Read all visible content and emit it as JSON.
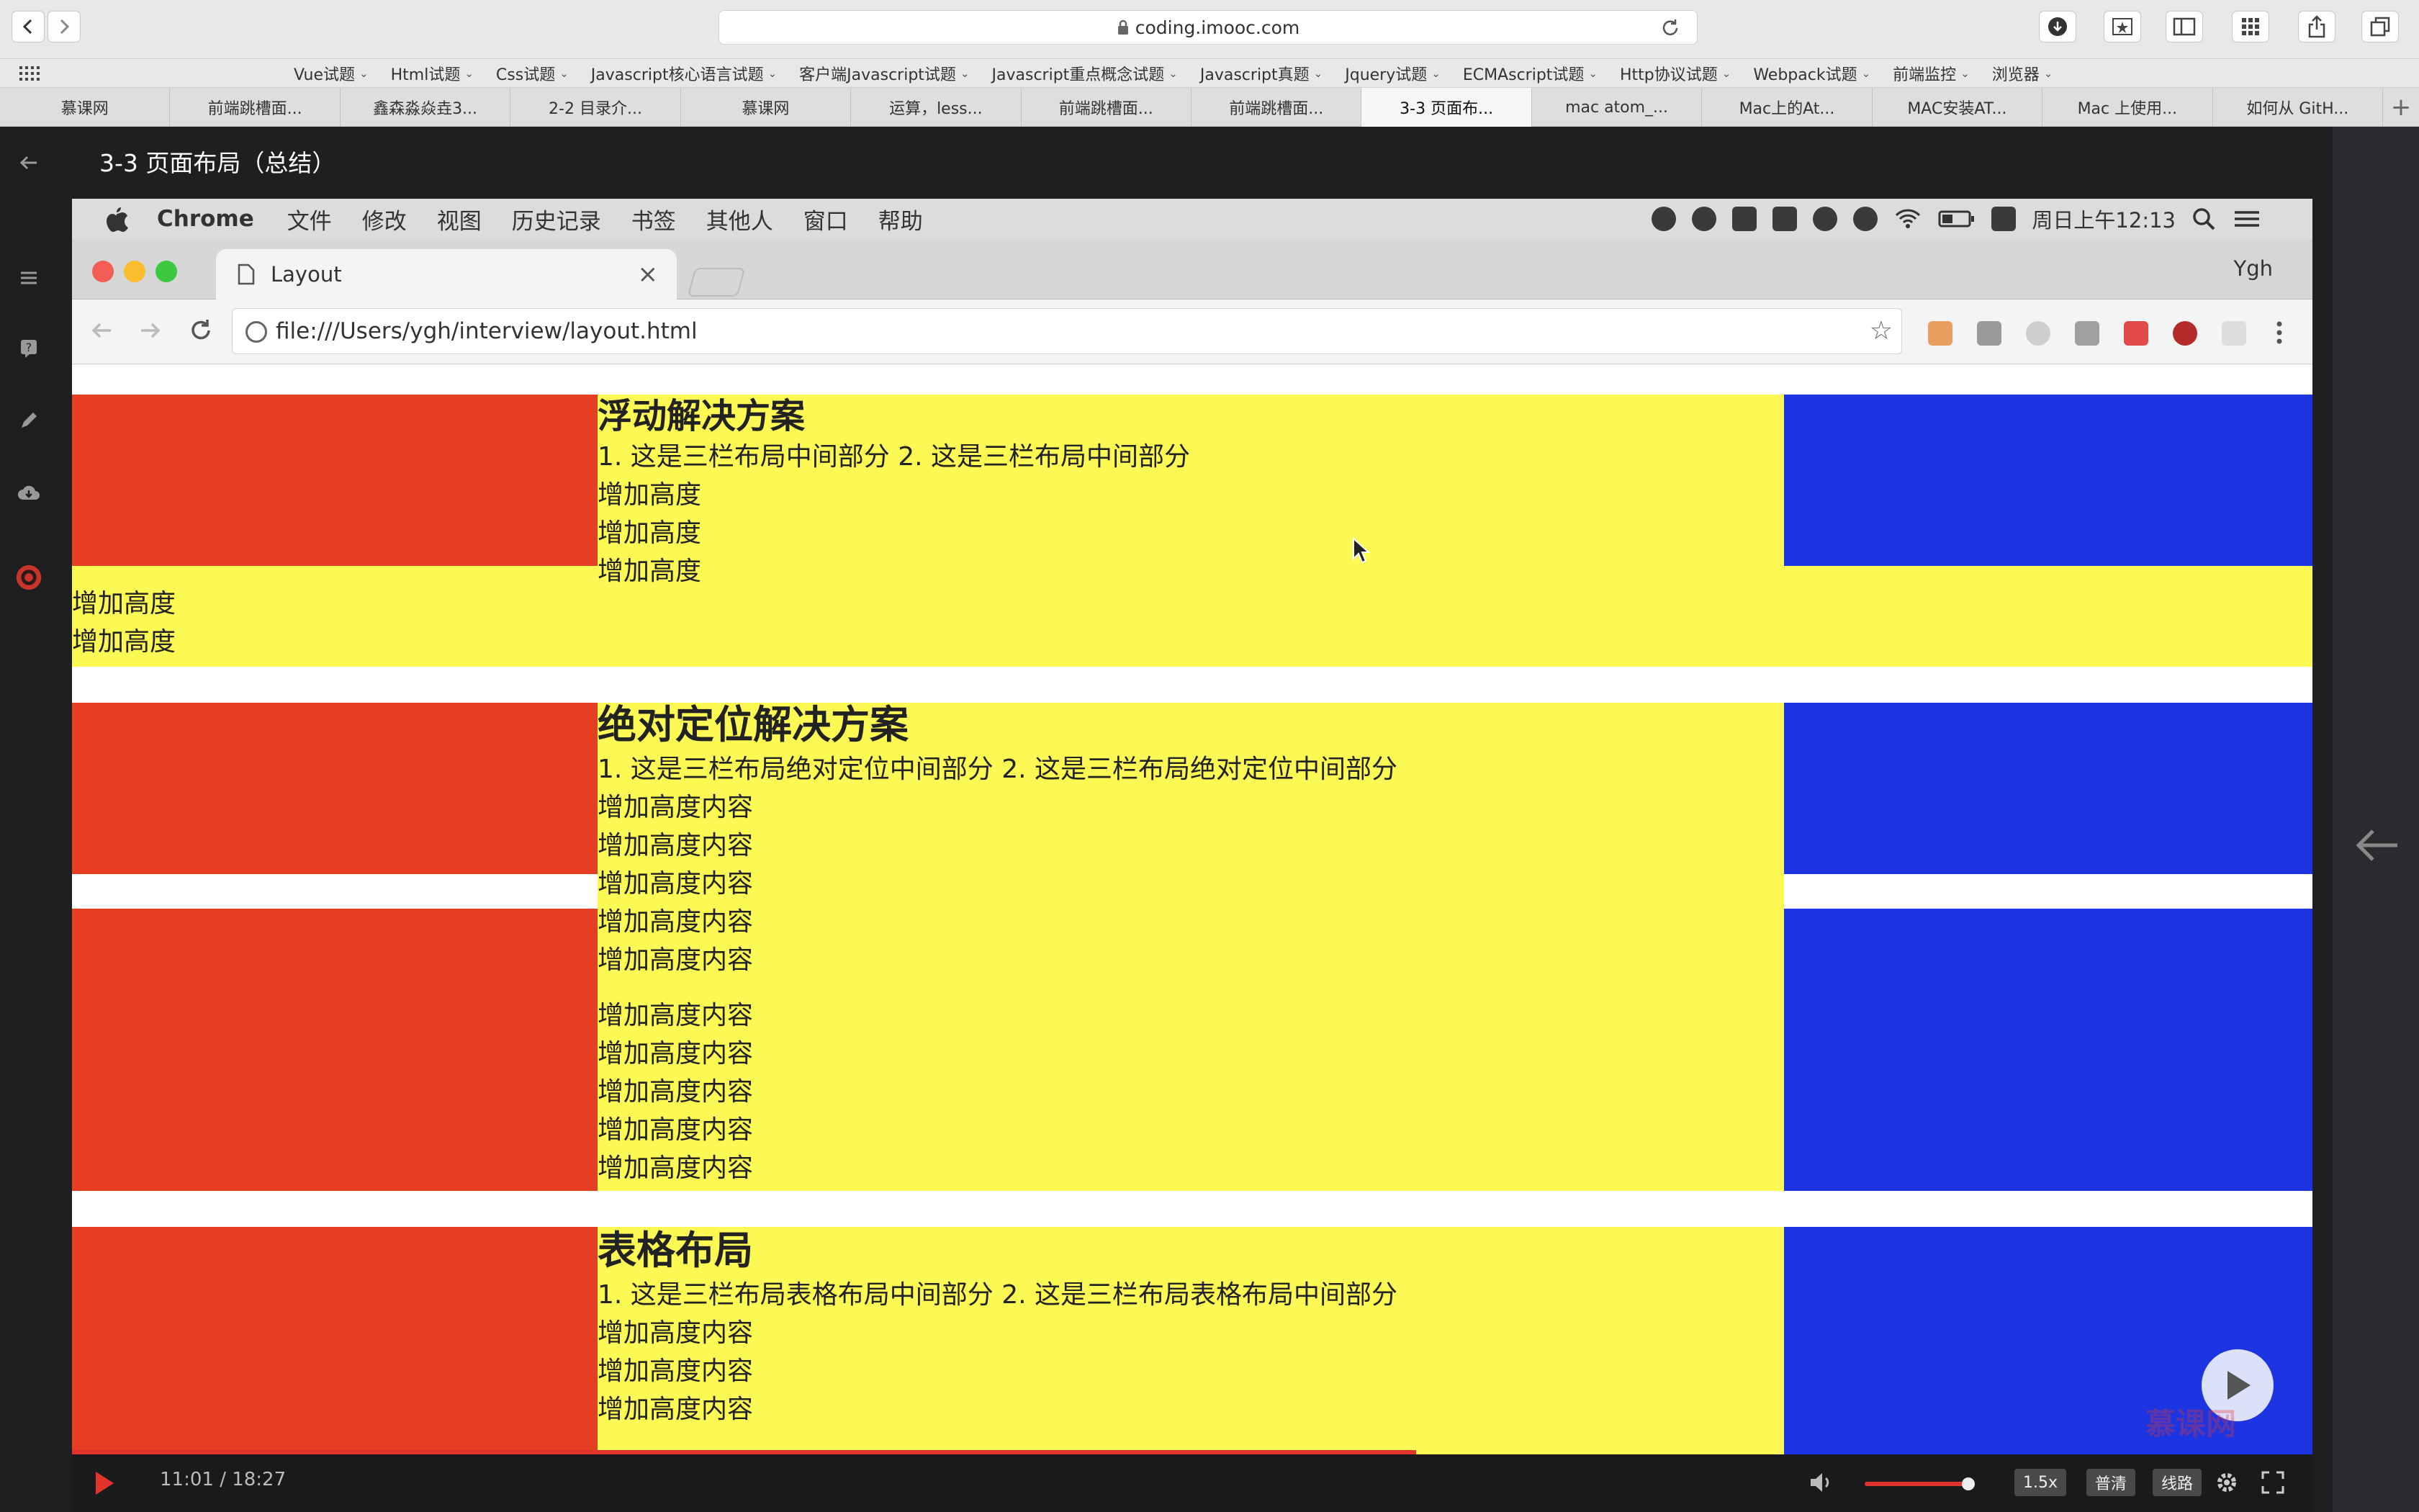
{
  "safari": {
    "url": "coding.imooc.com",
    "bookmarks": [
      "Vue试题",
      "Html试题",
      "Css试题",
      "Javascript核心语言试题",
      "客户端Javascript试题",
      "Javascript重点概念试题",
      "Javascript真题",
      "Jquery试题",
      "ECMAscript试题",
      "Http协议试题",
      "Webpack试题",
      "前端监控",
      "浏览器"
    ],
    "tabs": [
      "慕课网",
      "前端跳槽面...",
      "鑫森淼焱垚3...",
      "2-2 目录介...",
      "慕课网",
      "运算，less...",
      "前端跳槽面...",
      "前端跳槽面...",
      "3-3 页面布...",
      "mac atom_...",
      "Mac上的At...",
      "MAC安装AT...",
      "Mac 上使用...",
      "如何从 GitH..."
    ],
    "active_tab_index": 8,
    "add_tab": "+"
  },
  "player": {
    "lesson_title": "3-3 页面布局（总结）",
    "time": "11:01 / 18:27",
    "speed": "1.5x",
    "quality": "普清",
    "route": "线路",
    "progress": 0.6,
    "volume": 0.9
  },
  "video": {
    "mac_menubar": {
      "app": "Chrome",
      "menus": [
        "文件",
        "修改",
        "视图",
        "历史记录",
        "书签",
        "其他人",
        "窗口",
        "帮助"
      ],
      "clock": "周日上午12:13"
    },
    "chrome": {
      "tab_title": "Layout",
      "tab_close": "×",
      "user": "Ygh",
      "url": "file:///Users/ygh/interview/layout.html"
    },
    "page": {
      "float_section": {
        "title": "浮动解决方案",
        "line": "1. 这是三栏布局中间部分 2. 这是三栏布局中间部分",
        "lines": [
          "增加高度",
          "增加高度",
          "增加高度",
          "增加高度",
          "增加高度"
        ]
      },
      "absolute_section": {
        "title": "绝对定位解决方案",
        "line": "1. 这是三栏布局绝对定位中间部分 2. 这是三栏布局绝对定位中间部分",
        "lines": [
          "增加高度内容",
          "增加高度内容",
          "增加高度内容",
          "增加高度内容",
          "增加高度内容"
        ],
        "lines2": [
          "增加高度内容",
          "增加高度内容",
          "增加高度内容",
          "增加高度内容",
          "增加高度内容"
        ]
      },
      "table_section": {
        "title": "表格布局",
        "line": "1. 这是三栏布局表格布局中间部分 2. 这是三栏布局表格布局中间部分",
        "lines": [
          "增加高度内容",
          "增加高度内容",
          "增加高度内容"
        ]
      }
    },
    "watermark": "慕课网"
  },
  "colors": {
    "red": "#e53e22",
    "yellow": "#fcf854",
    "blue": "#1c34e2",
    "accent": "#e2332d"
  }
}
